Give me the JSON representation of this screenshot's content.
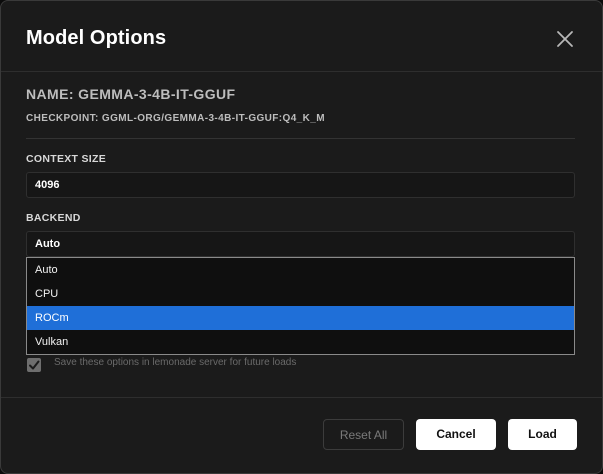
{
  "dialog": {
    "title": "Model Options",
    "close_icon": "close-icon"
  },
  "model": {
    "name": "NAME: GEMMA-3-4B-IT-GGUF",
    "checkpoint": "CHECKPOINT: GGML-ORG/GEMMA-3-4B-IT-GGUF:Q4_K_M"
  },
  "context_size": {
    "label": "CONTEXT SIZE",
    "value": "4096"
  },
  "backend": {
    "label": "BACKEND",
    "selected": "Auto",
    "options": [
      "Auto",
      "CPU",
      "ROCm",
      "Vulkan"
    ],
    "highlighted": "ROCm"
  },
  "save_options": {
    "label": "Save these options in lemonade server for future loads",
    "checked": true
  },
  "buttons": {
    "reset": "Reset All",
    "cancel": "Cancel",
    "load": "Load"
  },
  "colors": {
    "accent": "#1f6fd8",
    "background": "#1b1b1b"
  }
}
